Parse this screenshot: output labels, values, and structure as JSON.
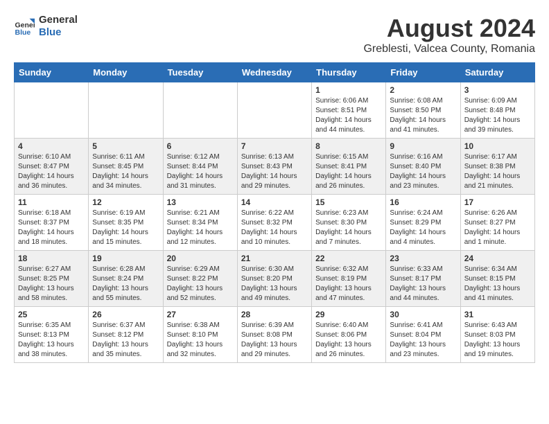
{
  "header": {
    "logo_general": "General",
    "logo_blue": "Blue",
    "month_title": "August 2024",
    "location": "Greblesti, Valcea County, Romania"
  },
  "days_of_week": [
    "Sunday",
    "Monday",
    "Tuesday",
    "Wednesday",
    "Thursday",
    "Friday",
    "Saturday"
  ],
  "weeks": [
    [
      {
        "day": "",
        "content": ""
      },
      {
        "day": "",
        "content": ""
      },
      {
        "day": "",
        "content": ""
      },
      {
        "day": "",
        "content": ""
      },
      {
        "day": "1",
        "content": "Sunrise: 6:06 AM\nSunset: 8:51 PM\nDaylight: 14 hours and 44 minutes."
      },
      {
        "day": "2",
        "content": "Sunrise: 6:08 AM\nSunset: 8:50 PM\nDaylight: 14 hours and 41 minutes."
      },
      {
        "day": "3",
        "content": "Sunrise: 6:09 AM\nSunset: 8:48 PM\nDaylight: 14 hours and 39 minutes."
      }
    ],
    [
      {
        "day": "4",
        "content": "Sunrise: 6:10 AM\nSunset: 8:47 PM\nDaylight: 14 hours and 36 minutes."
      },
      {
        "day": "5",
        "content": "Sunrise: 6:11 AM\nSunset: 8:45 PM\nDaylight: 14 hours and 34 minutes."
      },
      {
        "day": "6",
        "content": "Sunrise: 6:12 AM\nSunset: 8:44 PM\nDaylight: 14 hours and 31 minutes."
      },
      {
        "day": "7",
        "content": "Sunrise: 6:13 AM\nSunset: 8:43 PM\nDaylight: 14 hours and 29 minutes."
      },
      {
        "day": "8",
        "content": "Sunrise: 6:15 AM\nSunset: 8:41 PM\nDaylight: 14 hours and 26 minutes."
      },
      {
        "day": "9",
        "content": "Sunrise: 6:16 AM\nSunset: 8:40 PM\nDaylight: 14 hours and 23 minutes."
      },
      {
        "day": "10",
        "content": "Sunrise: 6:17 AM\nSunset: 8:38 PM\nDaylight: 14 hours and 21 minutes."
      }
    ],
    [
      {
        "day": "11",
        "content": "Sunrise: 6:18 AM\nSunset: 8:37 PM\nDaylight: 14 hours and 18 minutes."
      },
      {
        "day": "12",
        "content": "Sunrise: 6:19 AM\nSunset: 8:35 PM\nDaylight: 14 hours and 15 minutes."
      },
      {
        "day": "13",
        "content": "Sunrise: 6:21 AM\nSunset: 8:34 PM\nDaylight: 14 hours and 12 minutes."
      },
      {
        "day": "14",
        "content": "Sunrise: 6:22 AM\nSunset: 8:32 PM\nDaylight: 14 hours and 10 minutes."
      },
      {
        "day": "15",
        "content": "Sunrise: 6:23 AM\nSunset: 8:30 PM\nDaylight: 14 hours and 7 minutes."
      },
      {
        "day": "16",
        "content": "Sunrise: 6:24 AM\nSunset: 8:29 PM\nDaylight: 14 hours and 4 minutes."
      },
      {
        "day": "17",
        "content": "Sunrise: 6:26 AM\nSunset: 8:27 PM\nDaylight: 14 hours and 1 minute."
      }
    ],
    [
      {
        "day": "18",
        "content": "Sunrise: 6:27 AM\nSunset: 8:25 PM\nDaylight: 13 hours and 58 minutes."
      },
      {
        "day": "19",
        "content": "Sunrise: 6:28 AM\nSunset: 8:24 PM\nDaylight: 13 hours and 55 minutes."
      },
      {
        "day": "20",
        "content": "Sunrise: 6:29 AM\nSunset: 8:22 PM\nDaylight: 13 hours and 52 minutes."
      },
      {
        "day": "21",
        "content": "Sunrise: 6:30 AM\nSunset: 8:20 PM\nDaylight: 13 hours and 49 minutes."
      },
      {
        "day": "22",
        "content": "Sunrise: 6:32 AM\nSunset: 8:19 PM\nDaylight: 13 hours and 47 minutes."
      },
      {
        "day": "23",
        "content": "Sunrise: 6:33 AM\nSunset: 8:17 PM\nDaylight: 13 hours and 44 minutes."
      },
      {
        "day": "24",
        "content": "Sunrise: 6:34 AM\nSunset: 8:15 PM\nDaylight: 13 hours and 41 minutes."
      }
    ],
    [
      {
        "day": "25",
        "content": "Sunrise: 6:35 AM\nSunset: 8:13 PM\nDaylight: 13 hours and 38 minutes."
      },
      {
        "day": "26",
        "content": "Sunrise: 6:37 AM\nSunset: 8:12 PM\nDaylight: 13 hours and 35 minutes."
      },
      {
        "day": "27",
        "content": "Sunrise: 6:38 AM\nSunset: 8:10 PM\nDaylight: 13 hours and 32 minutes."
      },
      {
        "day": "28",
        "content": "Sunrise: 6:39 AM\nSunset: 8:08 PM\nDaylight: 13 hours and 29 minutes."
      },
      {
        "day": "29",
        "content": "Sunrise: 6:40 AM\nSunset: 8:06 PM\nDaylight: 13 hours and 26 minutes."
      },
      {
        "day": "30",
        "content": "Sunrise: 6:41 AM\nSunset: 8:04 PM\nDaylight: 13 hours and 23 minutes."
      },
      {
        "day": "31",
        "content": "Sunrise: 6:43 AM\nSunset: 8:03 PM\nDaylight: 13 hours and 19 minutes."
      }
    ]
  ]
}
